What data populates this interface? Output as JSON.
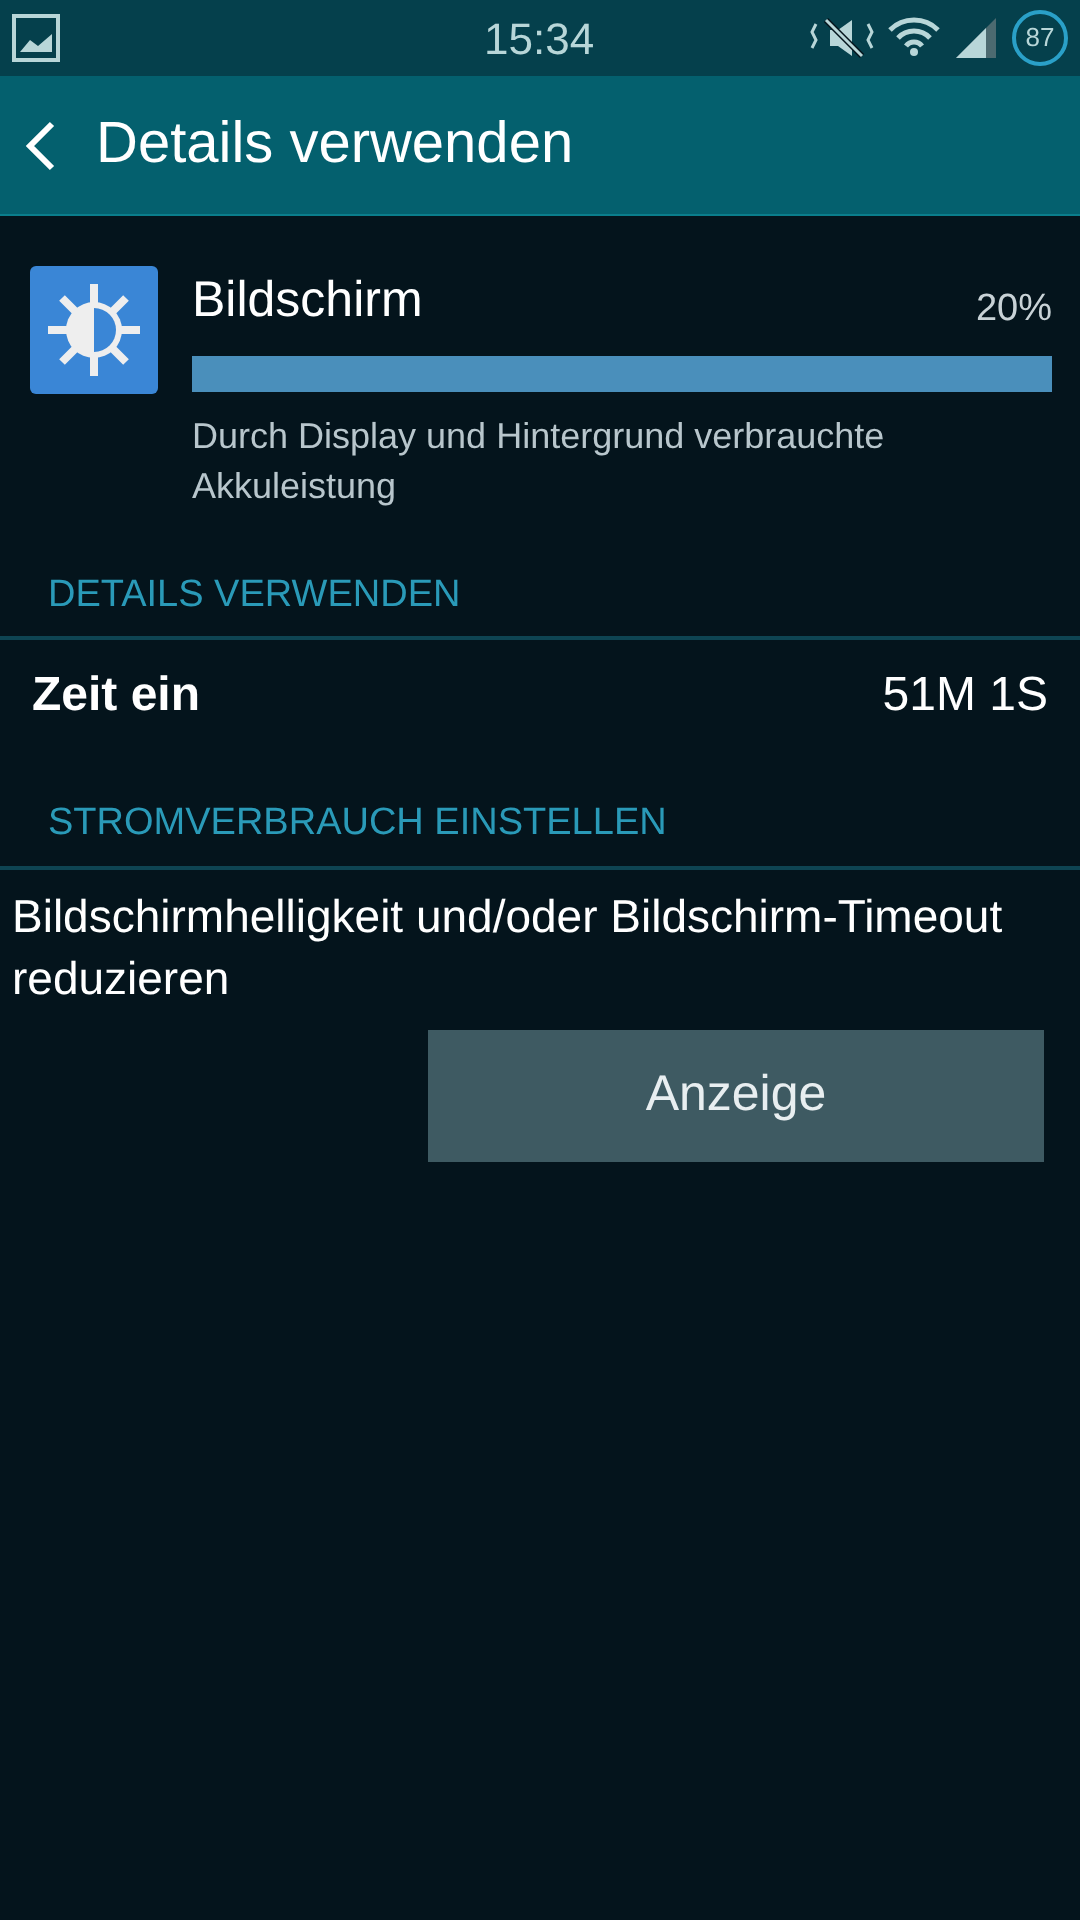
{
  "status_bar": {
    "time": "15:34",
    "battery": "87"
  },
  "header": {
    "title": "Details verwenden"
  },
  "app": {
    "name": "Bildschirm",
    "percent": "20%",
    "level": 1,
    "description": "Durch Display und Hintergrund verbrauchte Akkuleistung"
  },
  "sections": [
    {
      "title": "DETAILS VERWENDEN",
      "rows": [
        {
          "label": "Zeit ein",
          "value": "51M 1S"
        }
      ]
    },
    {
      "title": "STROMVERBRAUCH EINSTELLEN",
      "text": "Bildschirmhelligkeit und/oder Bildschirm-Timeout reduzieren",
      "button": "Anzeige"
    }
  ]
}
